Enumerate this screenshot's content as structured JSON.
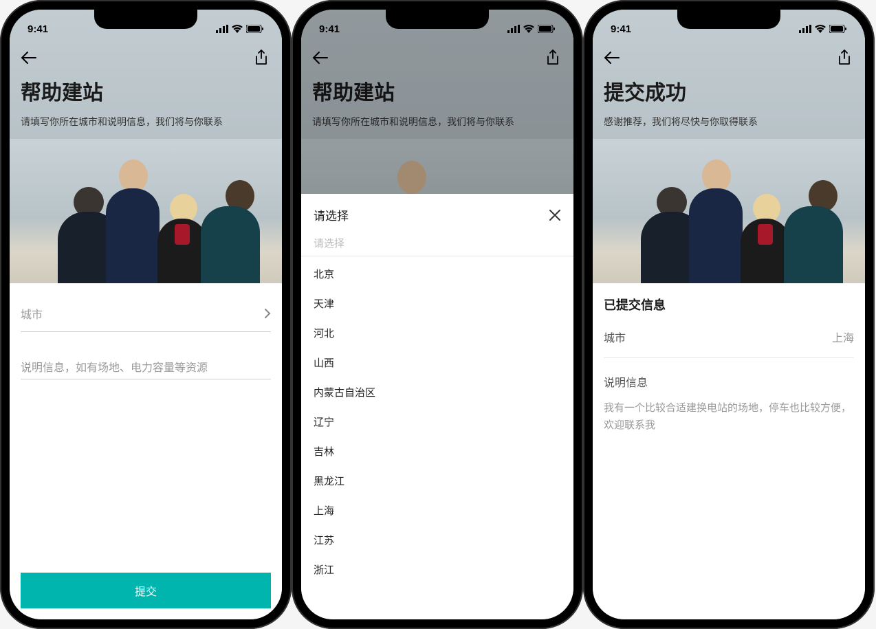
{
  "status": {
    "time": "9:41"
  },
  "screen1": {
    "title": "帮助建站",
    "subtitle": "请填写你所在城市和说明信息，我们将与你联系",
    "city_label": "城市",
    "notes_placeholder": "说明信息，如有场地、电力容量等资源",
    "submit": "提交"
  },
  "screen2": {
    "title": "帮助建站",
    "subtitle": "请填写你所在城市和说明信息，我们将与你联系",
    "sheet_title": "请选择",
    "search_placeholder": "请选择",
    "options": [
      "北京",
      "天津",
      "河北",
      "山西",
      "内蒙古自治区",
      "辽宁",
      "吉林",
      "黑龙江",
      "上海",
      "江苏",
      "浙江"
    ]
  },
  "screen3": {
    "title": "提交成功",
    "subtitle": "感谢推荐，我们将尽快与你取得联系",
    "submitted_head": "已提交信息",
    "city_key": "城市",
    "city_value": "上海",
    "notes_key": "说明信息",
    "notes_value": "我有一个比较合适建换电站的场地，停车也比较方便，欢迎联系我"
  }
}
